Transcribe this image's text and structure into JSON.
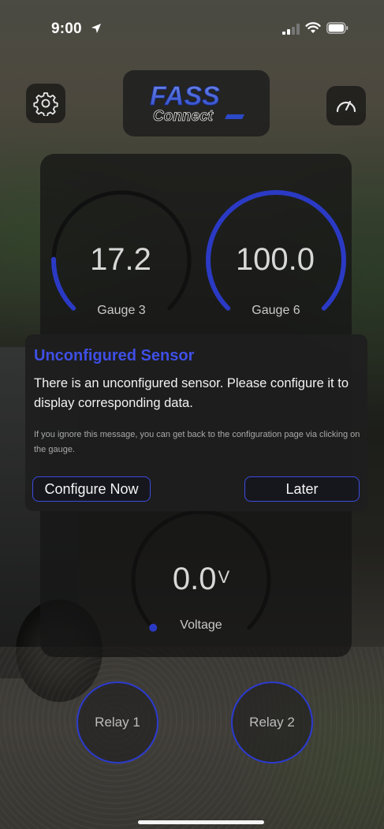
{
  "status_bar": {
    "time": "9:00",
    "icons": [
      "location-arrow-icon",
      "cellular-signal-icon",
      "wifi-icon",
      "battery-icon"
    ]
  },
  "header": {
    "settings_icon": "gear-icon",
    "gauges_icon": "speedometer-icon",
    "logo": {
      "brand_text": "FASS",
      "sub_text": "Connect"
    }
  },
  "gauges": [
    {
      "label": "Gauge 3",
      "value": "17.2",
      "unit": "",
      "fill_fraction": 0.17
    },
    {
      "label": "Gauge 6",
      "value": "100.0",
      "unit": "",
      "fill_fraction": 1.0
    },
    {
      "label": "Voltage",
      "value": "0.0",
      "unit": "V",
      "fill_fraction": 0.0
    }
  ],
  "alert": {
    "title": "Unconfigured Sensor",
    "message": "There is an unconfigured sensor. Please configure it to display corresponding data.",
    "note": "If you ignore this message, you can get back to the configuration page via clicking on the gauge.",
    "configure_label": "Configure Now",
    "later_label": "Later"
  },
  "relays": [
    {
      "label": "Relay 1"
    },
    {
      "label": "Relay 2"
    }
  ],
  "colors": {
    "accent": "#3f4fe6",
    "gauge_track": "#0f0f0f",
    "gauge_fill": "#2b3ac4"
  }
}
